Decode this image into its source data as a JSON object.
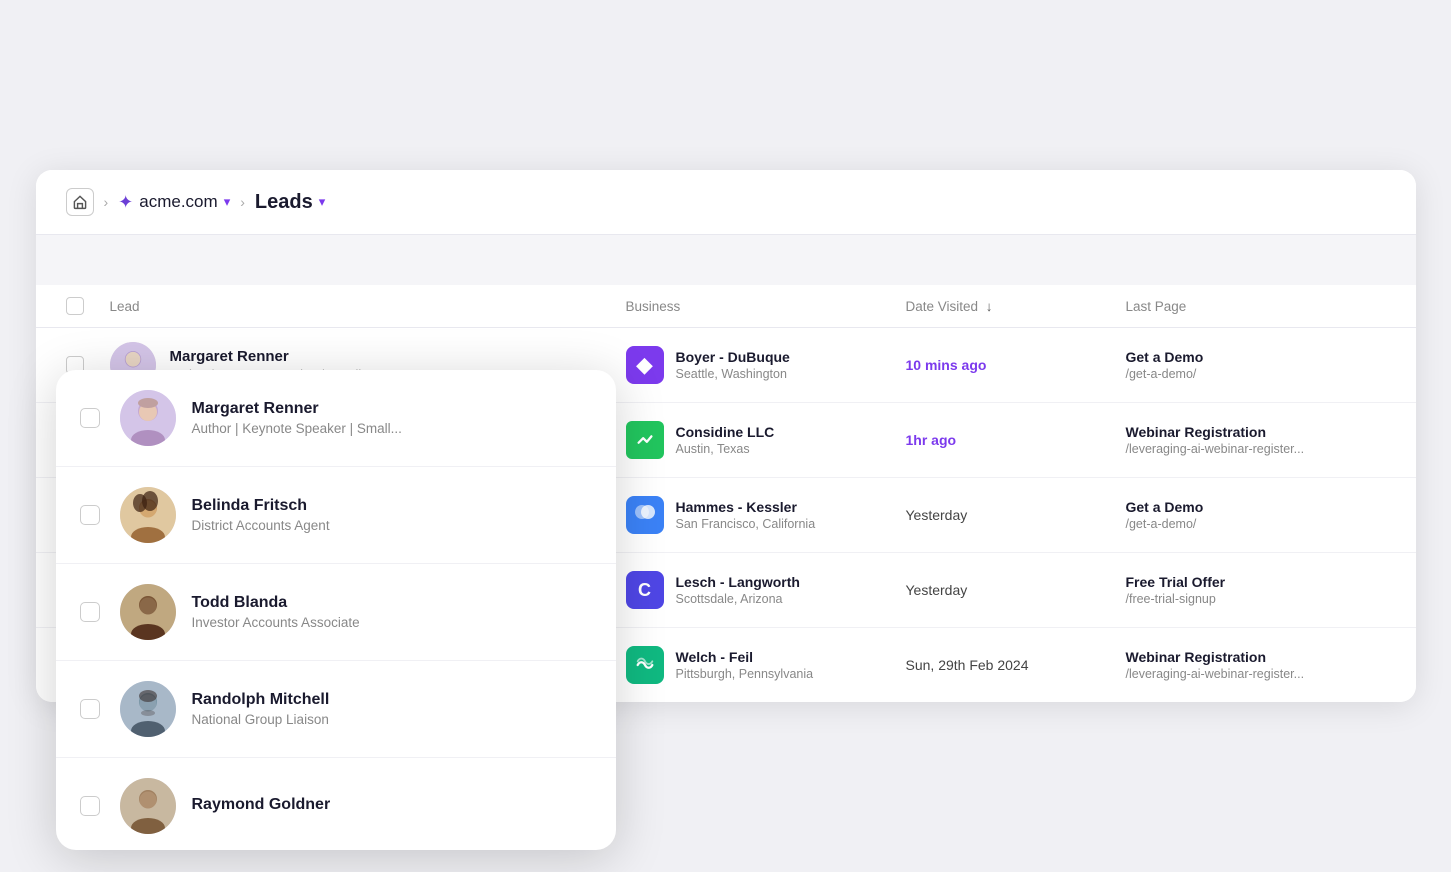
{
  "breadcrumb": {
    "home_label": "Home",
    "workspace": "acme.com",
    "section": "Leads"
  },
  "table": {
    "columns": [
      "Lead",
      "Business",
      "Date Visited",
      "Last Page"
    ],
    "rows": [
      {
        "id": 1,
        "name": "Margaret Renner",
        "title": "Author | Keynote Speaker | Small...",
        "business_name": "Boyer - DuBuque",
        "business_location": "Seattle, Washington",
        "date_visited": "10 mins ago",
        "date_hot": true,
        "last_page_title": "Get a Demo",
        "last_page_url": "/get-a-demo/",
        "logo_icon": "◆",
        "logo_class": "logo-purple"
      },
      {
        "id": 2,
        "name": "Belinda Fritsch",
        "title": "District Accounts Agent",
        "business_name": "Considine LLC",
        "business_location": "Austin, Texas",
        "date_visited": "1hr ago",
        "date_hot": true,
        "last_page_title": "Webinar Registration",
        "last_page_url": "/leveraging-ai-webinar-register...",
        "logo_icon": "⚡",
        "logo_class": "logo-green"
      },
      {
        "id": 3,
        "name": "Todd Blanda",
        "title": "Investor Accounts Associate",
        "business_name": "Hammes - Kessler",
        "business_location": "San Francisco, California",
        "date_visited": "Yesterday",
        "date_hot": false,
        "last_page_title": "Get a Demo",
        "last_page_url": "/get-a-demo/",
        "logo_icon": "●",
        "logo_class": "logo-blue"
      },
      {
        "id": 4,
        "name": "Randolph Mitchell",
        "title": "National Group Liaison",
        "business_name": "Lesch - Langworth",
        "business_location": "Scottsdale, Arizona",
        "date_visited": "Yesterday",
        "date_hot": false,
        "last_page_title": "Free Trial Offer",
        "last_page_url": "/free-trial-signup",
        "logo_icon": "C",
        "logo_class": "logo-indigo"
      },
      {
        "id": 5,
        "name": "Raymond Goldner",
        "title": "",
        "business_name": "Welch - Feil",
        "business_location": "Pittsburgh, Pennsylvania",
        "date_visited": "Sun, 29th Feb 2024",
        "date_hot": false,
        "last_page_title": "Webinar Registration",
        "last_page_url": "/leveraging-ai-webinar-register...",
        "logo_icon": "≋",
        "logo_class": "logo-emerald"
      }
    ]
  },
  "overlay": {
    "items": [
      {
        "name": "Margaret Renner",
        "title": "Author | Keynote Speaker | Small..."
      },
      {
        "name": "Belinda Fritsch",
        "title": "District Accounts Agent"
      },
      {
        "name": "Todd Blanda",
        "title": "Investor Accounts Associate"
      },
      {
        "name": "Randolph Mitchell",
        "title": "National Group Liaison"
      },
      {
        "name": "Raymond Goldner",
        "title": ""
      }
    ]
  },
  "colors": {
    "accent": "#7c3aed",
    "hot": "#7c3aed"
  }
}
